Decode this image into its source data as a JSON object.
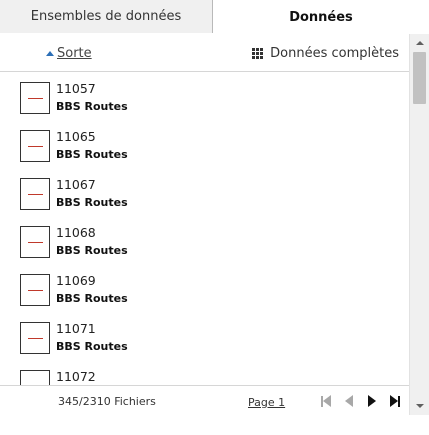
{
  "tabs": [
    {
      "label": "Ensembles de données",
      "active": false
    },
    {
      "label": "Données",
      "active": true
    }
  ],
  "toolbar": {
    "sort_label": "Sorte",
    "full_data_label": "Données complètes",
    "full_data_icon": "grid-icon"
  },
  "items": [
    {
      "id": "11057",
      "name": "BBS Routes"
    },
    {
      "id": "11065",
      "name": "BBS Routes"
    },
    {
      "id": "11067",
      "name": "BBS Routes"
    },
    {
      "id": "11068",
      "name": "BBS Routes"
    },
    {
      "id": "11069",
      "name": "BBS Routes"
    },
    {
      "id": "11071",
      "name": "BBS Routes"
    },
    {
      "id": "11072",
      "name": ""
    }
  ],
  "footer": {
    "count_label": "345/2310  Fichiers",
    "page_label": "Page 1"
  },
  "colors": {
    "accent": "#2c6fb7",
    "thumb_line": "#c0392b"
  }
}
